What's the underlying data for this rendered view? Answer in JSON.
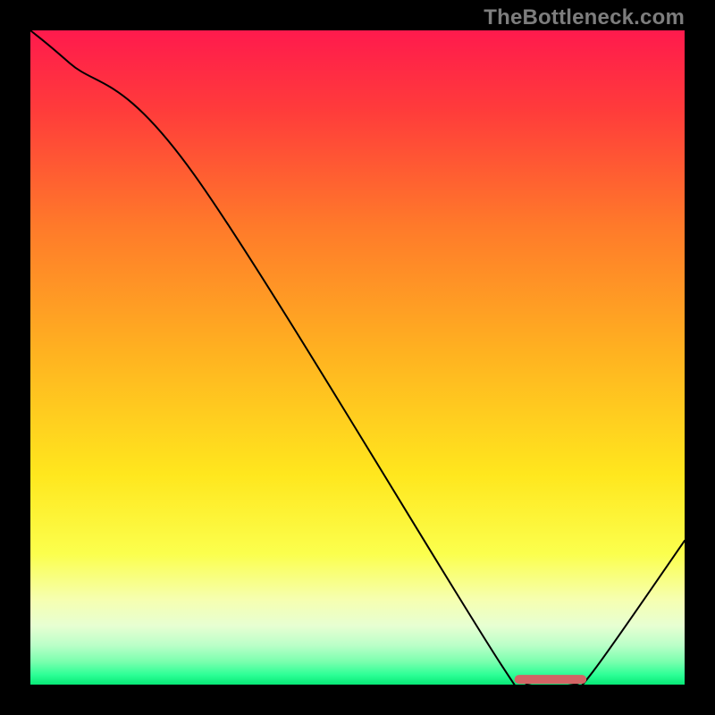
{
  "watermark": "TheBottleneck.com",
  "chart_data": {
    "type": "line",
    "title": "",
    "xlabel": "",
    "ylabel": "",
    "xlim": [
      0,
      100
    ],
    "ylim": [
      0,
      100
    ],
    "curve": {
      "name": "bottleneck-curve",
      "x": [
        0,
        6,
        25,
        72,
        76,
        83,
        86,
        100
      ],
      "y": [
        100,
        95,
        78,
        3,
        0,
        0,
        2,
        22
      ]
    },
    "optimal_region": {
      "name": "optimal-marker",
      "color": "#d26565",
      "y": 0.8,
      "x_start": 74,
      "x_end": 85,
      "thickness": 10,
      "rx": 5
    },
    "gradient_stops": [
      {
        "offset": 0.0,
        "color": "#ff1a4d"
      },
      {
        "offset": 0.12,
        "color": "#ff3b3b"
      },
      {
        "offset": 0.3,
        "color": "#ff7a2a"
      },
      {
        "offset": 0.5,
        "color": "#ffb420"
      },
      {
        "offset": 0.68,
        "color": "#ffe71e"
      },
      {
        "offset": 0.8,
        "color": "#fbff4d"
      },
      {
        "offset": 0.87,
        "color": "#f6ffb0"
      },
      {
        "offset": 0.91,
        "color": "#e7ffd2"
      },
      {
        "offset": 0.94,
        "color": "#baffc8"
      },
      {
        "offset": 0.965,
        "color": "#7affae"
      },
      {
        "offset": 0.985,
        "color": "#2dff96"
      },
      {
        "offset": 1.0,
        "color": "#07e876"
      }
    ]
  }
}
